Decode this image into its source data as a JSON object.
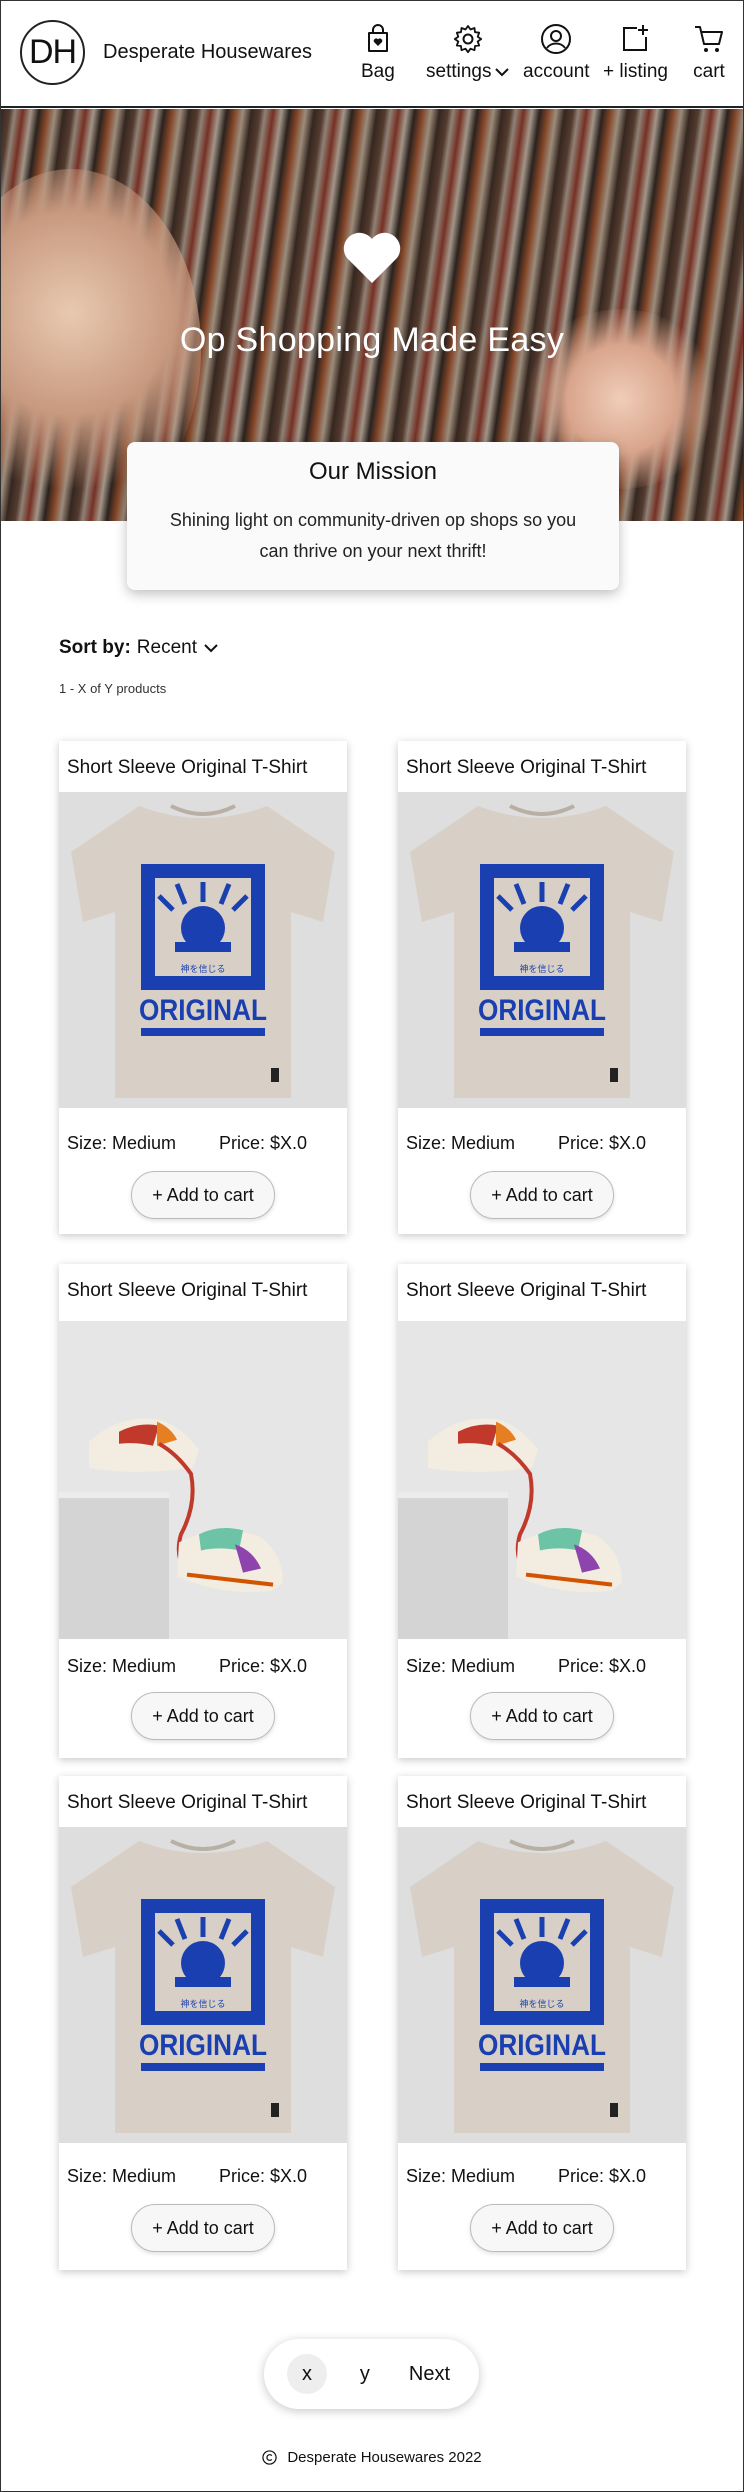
{
  "header": {
    "logo_text": "DH",
    "brand": "Desperate Housewares",
    "nav": [
      {
        "label": "Bag",
        "icon": "bag-icon"
      },
      {
        "label": "settings",
        "icon": "gear-icon"
      },
      {
        "label": "account",
        "icon": "account-icon"
      },
      {
        "label": "+ listing",
        "icon": "add-listing-icon"
      },
      {
        "label": "cart",
        "icon": "cart-icon"
      }
    ]
  },
  "hero": {
    "icon": "heart-icon",
    "title": "Op Shopping Made Easy"
  },
  "mission": {
    "title": "Our Mission",
    "text": "Shining light on community-driven op shops so you can thrive on your next thrift!"
  },
  "sort": {
    "label": "Sort by:",
    "value": "Recent",
    "count": "1 - X of Y products"
  },
  "products": [
    {
      "title": "Short Sleeve Original T-Shirt",
      "image": "tshirt",
      "size": "Size: Medium",
      "price": "Price: $X.0",
      "button": "Add to cart"
    },
    {
      "title": "Short Sleeve Original T-Shirt",
      "image": "tshirt",
      "size": "Size: Medium",
      "price": "Price: $X.0",
      "button": "Add to cart"
    },
    {
      "title": "Short Sleeve Original T-Shirt",
      "image": "sneakers",
      "size": "Size: Medium",
      "price": "Price: $X.0",
      "button": "Add to cart"
    },
    {
      "title": "Short Sleeve Original T-Shirt",
      "image": "sneakers",
      "size": "Size: Medium",
      "price": "Price: $X.0",
      "button": "Add to cart"
    },
    {
      "title": "Short Sleeve Original T-Shirt",
      "image": "tshirt",
      "size": "Size: Medium",
      "price": "Price: $X.0",
      "button": "Add to cart"
    },
    {
      "title": "Short Sleeve Original T-Shirt",
      "image": "tshirt",
      "size": "Size: Medium",
      "price": "Price: $X.0",
      "button": "Add to cart"
    }
  ],
  "shirt_print": {
    "word": "ORIGINAL",
    "tag": "神を信じる",
    "accent": "#1a3fb0",
    "shirt_color": "#d8d0c6"
  },
  "pagination": {
    "pages": [
      "x",
      "y"
    ],
    "active": "x",
    "next": "Next"
  },
  "footer": {
    "icon": "copyright-icon",
    "text": "Desperate Housewares 2022"
  }
}
